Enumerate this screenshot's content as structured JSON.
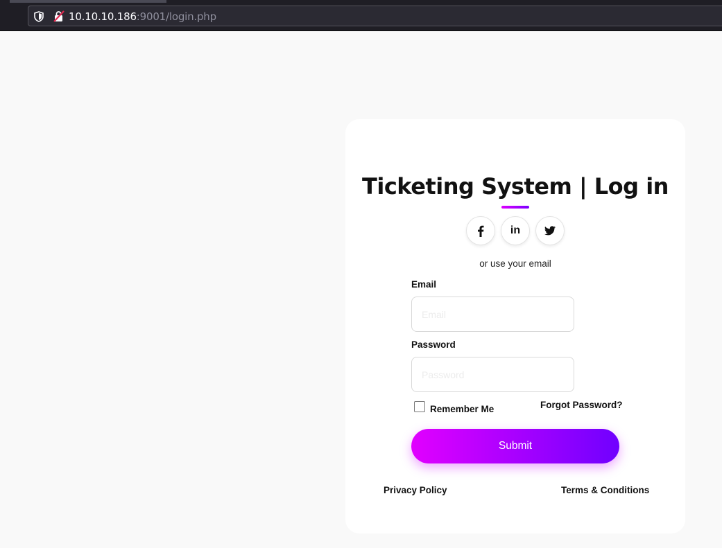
{
  "browser": {
    "url_host": "10.10.10.186",
    "url_rest": ":9001/login.php",
    "icons": [
      "shield-icon",
      "insecure-lock-icon"
    ]
  },
  "login": {
    "title": "Ticketing System | Log in",
    "social": {
      "facebook_icon": "facebook-icon",
      "linkedin_text": "in",
      "twitter_icon": "twitter-icon"
    },
    "or_use_email": "or use your email",
    "email_label": "Email",
    "email_placeholder": "Email",
    "email_value": "",
    "password_label": "Password",
    "password_placeholder": "Password",
    "password_value": "",
    "remember_label": "Remember Me",
    "remember_checked": false,
    "forgot_label": "Forgot Password?",
    "submit_label": "Submit",
    "privacy_label": "Privacy Policy",
    "terms_label": "Terms & Conditions"
  },
  "colors": {
    "page_bg": "#f9f9f9",
    "accent_start": "#e100ff",
    "accent_end": "#7000ff",
    "chrome_bg": "#1f1e25"
  }
}
